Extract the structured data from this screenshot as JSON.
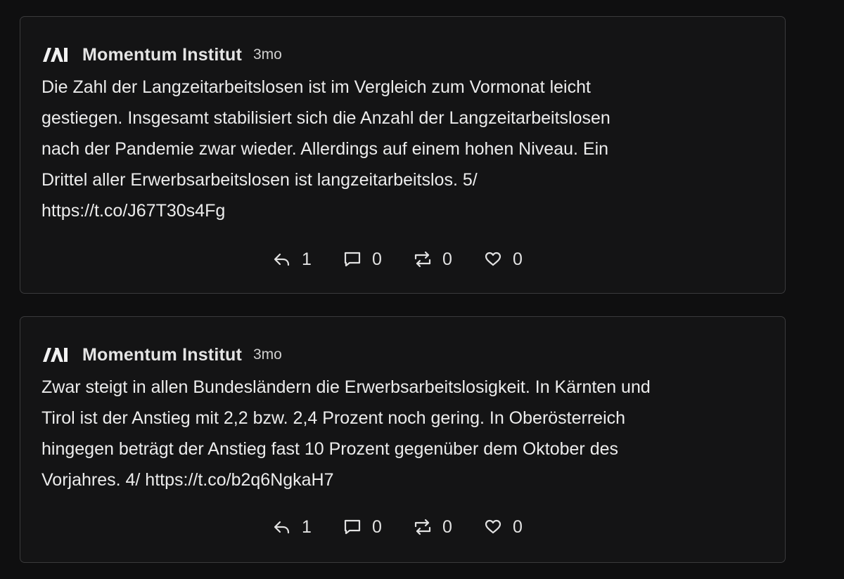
{
  "posts": [
    {
      "author": "Momentum Institut",
      "time": "3mo",
      "avatar_icon": "momentum-logo-icon",
      "lines": [
        "Die Zahl der Langzeitarbeitslosen ist im Vergleich zum Vormonat leicht",
        "gestiegen. Insgesamt stabilisiert sich die Anzahl der Langzeitarbeitslosen",
        "nach der Pandemie zwar wieder. Allerdings auf einem hohen Niveau. Ein",
        "Drittel aller Erwerbsarbeitslosen ist langzeitarbeitslos. 5/",
        "https://t.co/J67T30s4Fg"
      ],
      "actions": {
        "reply": {
          "icon": "reply-icon",
          "count": "1"
        },
        "comment": {
          "icon": "comment-icon",
          "count": "0"
        },
        "repost": {
          "icon": "repost-icon",
          "count": "0"
        },
        "like": {
          "icon": "heart-icon",
          "count": "0"
        }
      }
    },
    {
      "author": "Momentum Institut",
      "time": "3mo",
      "avatar_icon": "momentum-logo-icon",
      "lines": [
        "Zwar steigt in allen Bundesländern die Erwerbsarbeitslosigkeit. In Kärnten und",
        "Tirol ist der Anstieg mit 2,2 bzw. 2,4 Prozent noch gering. In Oberösterreich",
        "hingegen beträgt der Anstieg fast 10 Prozent gegenüber dem Oktober des",
        "Vorjahres. 4/ https://t.co/b2q6NgkaH7"
      ],
      "actions": {
        "reply": {
          "icon": "reply-icon",
          "count": "1"
        },
        "comment": {
          "icon": "comment-icon",
          "count": "0"
        },
        "repost": {
          "icon": "repost-icon",
          "count": "0"
        },
        "like": {
          "icon": "heart-icon",
          "count": "0"
        }
      }
    }
  ],
  "colors": {
    "background": "#0f0f10",
    "card": "#141415",
    "border": "#3a3a3c",
    "text": "#ececec",
    "muted": "#d0d0d0"
  }
}
